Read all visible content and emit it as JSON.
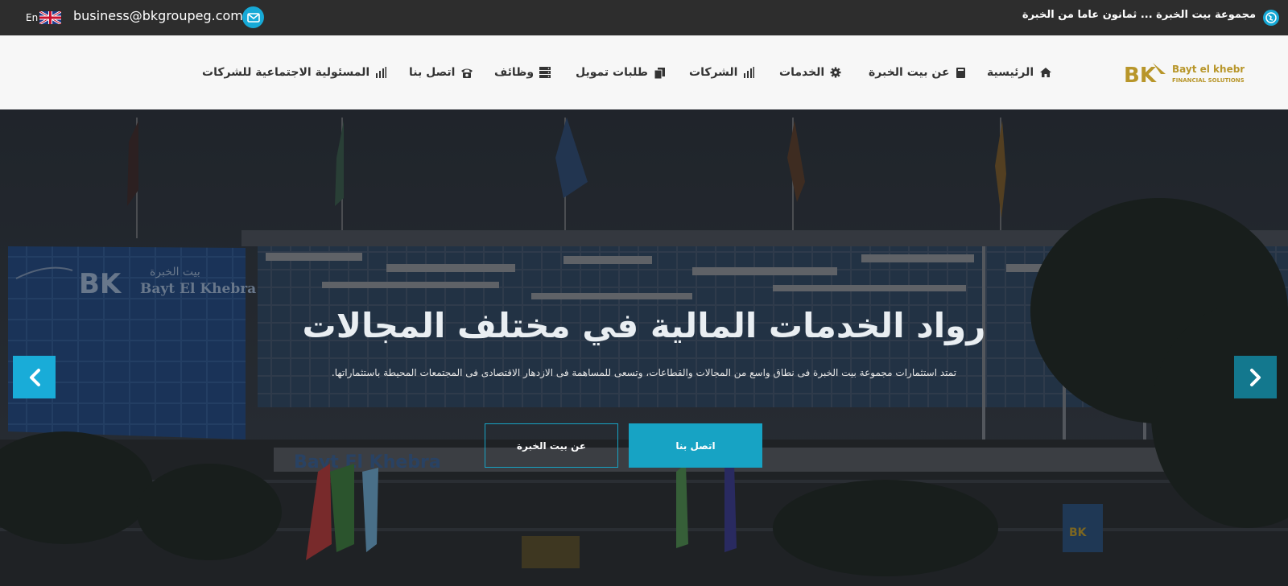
{
  "topbar": {
    "tagline": "مجموعة بيت الخبرة ... ثمانون عاما من الخبرة",
    "email": "business@bkgroupeg.com",
    "language": "En",
    "icons": [
      "globe-icon",
      "uk-flag-icon",
      "envelope-icon"
    ]
  },
  "logo": {
    "name": "Bayt el khebra",
    "tagline": "FINANCIAL SOLUTIONS",
    "mark": "BK"
  },
  "nav": {
    "items": [
      {
        "label": "الرئيسية",
        "icon": "home-icon"
      },
      {
        "label": "عن بيت الخبرة",
        "icon": "book-icon"
      },
      {
        "label": "الخدمات",
        "icon": "gear-icon"
      },
      {
        "label": "الشركات",
        "icon": "bar-chart-icon"
      },
      {
        "label": "طلبات تمويل",
        "icon": "files-icon"
      },
      {
        "label": "وظائف",
        "icon": "server-icon"
      },
      {
        "label": "اتصل بنا",
        "icon": "phone-icon"
      },
      {
        "label": "المسئولية الاجتماعية للشركات",
        "icon": "bar-chart-icon"
      }
    ]
  },
  "hero": {
    "title": "رواد الخدمات المالية في مختلف المجالات",
    "subtitle": "تمتد استثمارات مجموعة بيت الخبرة فى نطاق واسع من المجالات والقطاعات، وتسعى للمساهمة فى الازدهار الاقتصادى فى المجتمعات المحيطة باستثماراتها.",
    "primary_button": "اتصل بنا",
    "secondary_button": "عن بيت الخبرة",
    "building_sign": "Bayt El Khebra",
    "building_sign_ar": "بيت الخبرة",
    "facade_text": "Bayt El Khebra",
    "accent_color": "#17a3c4"
  }
}
